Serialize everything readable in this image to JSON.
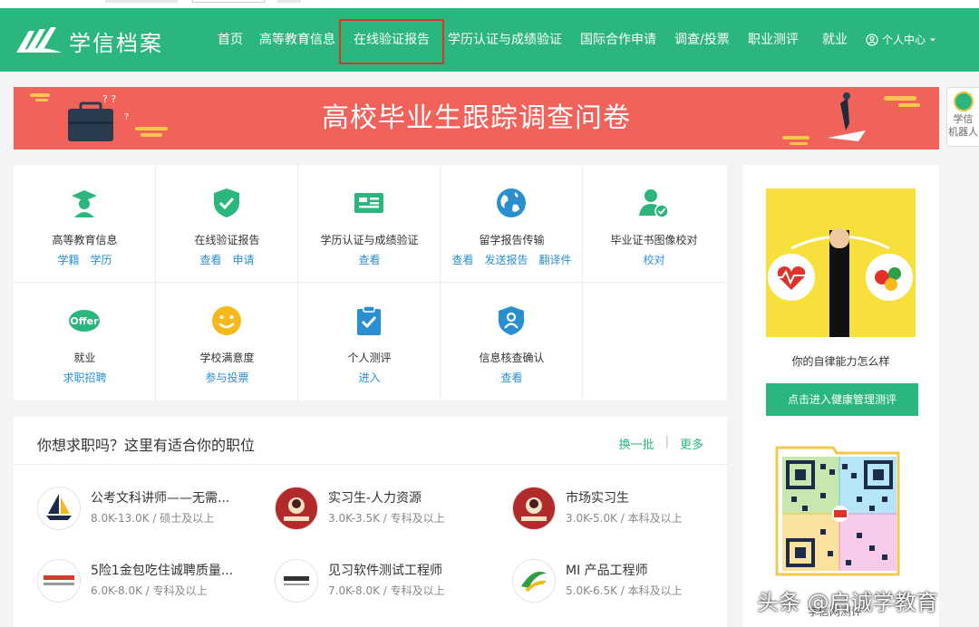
{
  "brand": {
    "name": "学信档案",
    "primary_color": "#2bb67d",
    "highlight_color": "#e0322b"
  },
  "nav": {
    "items": [
      "首页",
      "高等教育信息",
      "在线验证报告",
      "学历认证与成绩验证",
      "国际合作申请",
      "调查/投票",
      "职业测评",
      "就业"
    ],
    "user_menu": "个人中心"
  },
  "banner": {
    "title": "高校毕业生跟踪调查问卷",
    "color": "#f0625a"
  },
  "side_robot": {
    "label_line1": "学信",
    "label_line2": "机器人"
  },
  "services": [
    {
      "name": "高等教育信息",
      "icon": "graduate-icon",
      "links": [
        "学籍",
        "学历"
      ]
    },
    {
      "name": "在线验证报告",
      "icon": "shield-check-icon",
      "links": [
        "查看",
        "申请"
      ]
    },
    {
      "name": "学历认证与成绩验证",
      "icon": "id-card-icon",
      "links": [
        "查看"
      ]
    },
    {
      "name": "留学报告传输",
      "icon": "globe-icon",
      "links": [
        "查看",
        "发送报告",
        "翻译件"
      ]
    },
    {
      "name": "毕业证书图像校对",
      "icon": "user-check-icon",
      "links": [
        "校对"
      ]
    },
    {
      "name": "就业",
      "icon": "offer-icon",
      "links": [
        "求职招聘"
      ]
    },
    {
      "name": "学校满意度",
      "icon": "smiley-icon",
      "links": [
        "参与投票"
      ]
    },
    {
      "name": "个人测评",
      "icon": "clipboard-check-icon",
      "links": [
        "进入"
      ]
    },
    {
      "name": "信息核查确认",
      "icon": "shield-user-icon",
      "links": [
        "查看"
      ]
    }
  ],
  "jobs": {
    "title": "你想求职吗？这里有适合你的职位",
    "refresh_label": "换一批",
    "separator": "|",
    "more_label": "更多",
    "items": [
      {
        "title": "公考文科讲师——无需...",
        "meta": "8.0K-13.0K / 硕士及以上",
        "logo": "sailboat-logo-icon"
      },
      {
        "title": "实习生-人力资源",
        "meta": "3.0K-3.5K / 专科及以上",
        "logo": "restaurant-logo-icon"
      },
      {
        "title": "市场实习生",
        "meta": "3.0K-5.0K / 本科及以上",
        "logo": "restaurant-logo-icon"
      },
      {
        "title": "5险1金包吃住诚聘质量...",
        "meta": "6.0K-8.0K / 专科及以上",
        "logo": "wanbao-logo-icon"
      },
      {
        "title": "见习软件测试工程师",
        "meta": "7.0K-8.0K / 专科及以上",
        "logo": "software-group-logo-icon"
      },
      {
        "title": "MI 产品工程师",
        "meta": "5.0K-6.5K / 本科及以上",
        "logo": "green-logo-icon"
      }
    ]
  },
  "ad": {
    "caption": "你的自律能力怎么样",
    "button_label": "点击进入健康管理测评",
    "qr_caption": "学信网测评"
  },
  "watermark": "头条 @启诚学教育"
}
